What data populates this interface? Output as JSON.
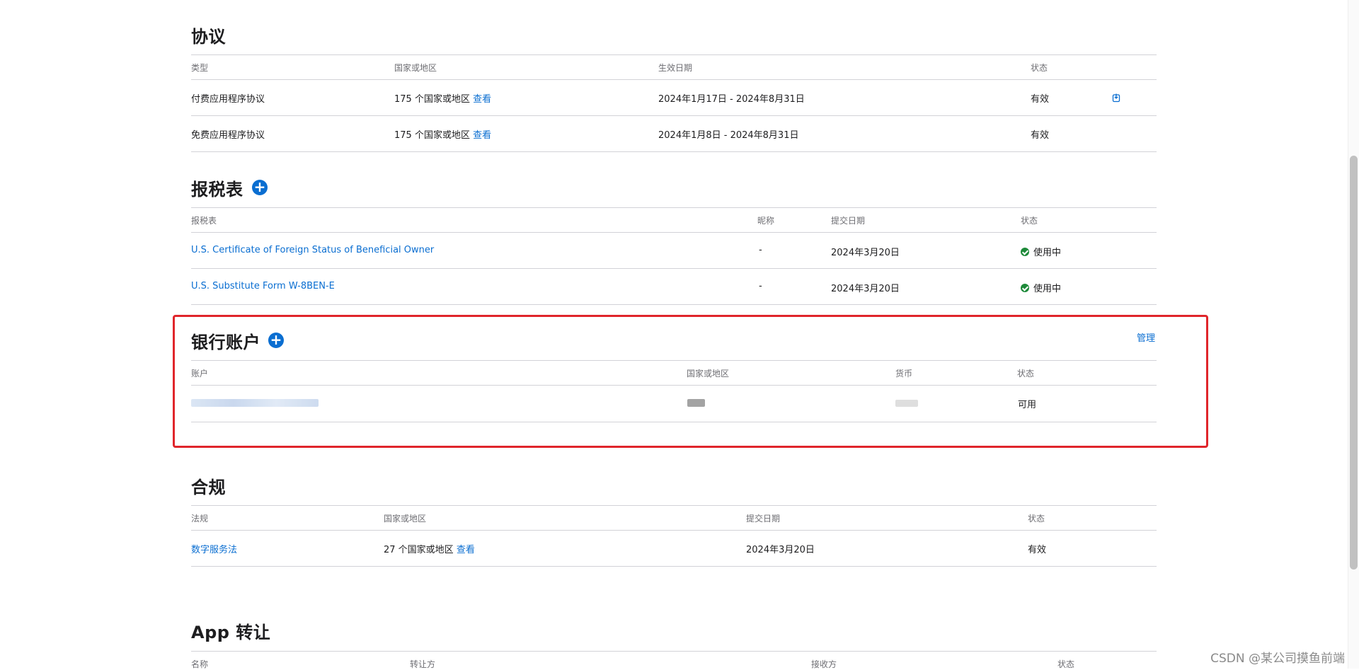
{
  "agreements": {
    "title": "协议",
    "headers": [
      "类型",
      "国家或地区",
      "生效日期",
      "状态"
    ],
    "rows": [
      {
        "type": "付费应用程序协议",
        "region_count": "175 个国家或地区",
        "view": "查看",
        "date": "2024年1月17日 - 2024年8月31日",
        "status": "有效"
      },
      {
        "type": "免费应用程序协议",
        "region_count": "175 个国家或地区",
        "view": "查看",
        "date": "2024年1月8日 - 2024年8月31日",
        "status": "有效"
      }
    ]
  },
  "tax_forms": {
    "title": "报税表",
    "add_symbol": "+",
    "headers": [
      "报税表",
      "昵称",
      "提交日期",
      "状态"
    ],
    "rows": [
      {
        "name": "U.S. Certificate of Foreign Status of Beneficial Owner",
        "nickname": "-",
        "date": "2024年3月20日",
        "status": "使用中"
      },
      {
        "name": "U.S. Substitute Form W-8BEN-E",
        "nickname": "-",
        "date": "2024年3月20日",
        "status": "使用中"
      }
    ]
  },
  "bank_accounts": {
    "title": "银行账户",
    "add_symbol": "+",
    "manage_label": "管理",
    "headers": [
      "账户",
      "国家或地区",
      "货币",
      "状态"
    ],
    "rows": [
      {
        "status": "可用"
      }
    ]
  },
  "compliance": {
    "title": "合规",
    "headers": [
      "法规",
      "国家或地区",
      "提交日期",
      "状态"
    ],
    "rows": [
      {
        "law": "数字服务法",
        "region_count": "27 个国家或地区",
        "view": "查看",
        "date": "2024年3月20日",
        "status": "有效"
      }
    ]
  },
  "app_transfer": {
    "title": "App 转让",
    "headers": [
      "名称",
      "转让方",
      "接收方",
      "状态"
    ]
  },
  "watermark": "CSDN @某公司摸鱼前端",
  "colors": {
    "link": "#0a6ed1",
    "highlight": "#e0252b",
    "success": "#1e8a3a"
  }
}
